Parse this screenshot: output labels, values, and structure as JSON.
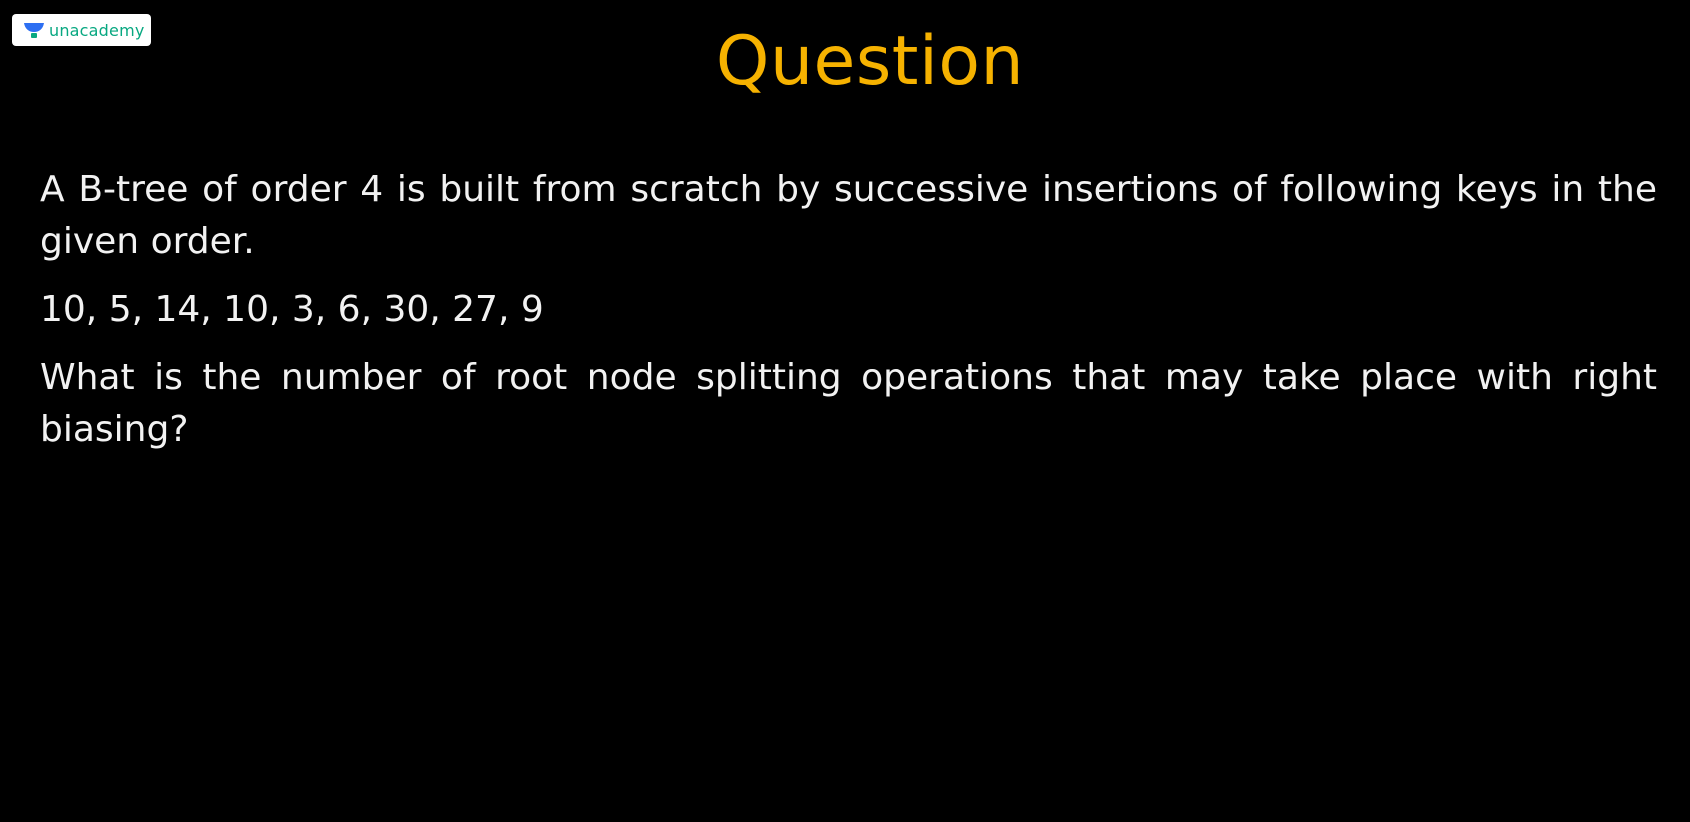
{
  "brand": {
    "name": "unacademy",
    "logo_icon": "unacademy-logo-icon",
    "logo_color": "#08a881",
    "badge_bg": "#ffffff"
  },
  "slide": {
    "title": "Question",
    "title_color": "#f6b200",
    "background": "#000000",
    "text_color": "#f2f2f2",
    "paragraph_1": "A B-tree of order 4 is built from scratch by successive insertions of following keys in the given order.",
    "keys_sequence": "10, 5, 14, 10, 3, 6, 30, 27, 9",
    "paragraph_2": "What is the number of root node splitting operations that may take place with right biasing?"
  }
}
